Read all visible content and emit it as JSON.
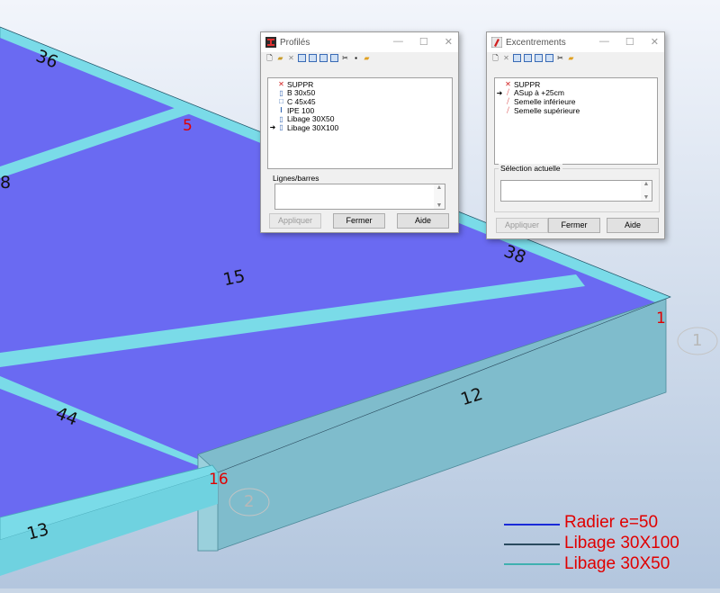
{
  "viewport": {
    "member_labels": [
      "36",
      "8",
      "15",
      "38",
      "44",
      "12",
      "13"
    ],
    "node_labels": [
      "5",
      "1",
      "16"
    ],
    "axis_labels": [
      "1",
      "2"
    ],
    "legend": [
      {
        "label": "Radier e=50",
        "color": "#1a2ad8"
      },
      {
        "label": "Libage 30X100",
        "color": "#2a4a5e"
      },
      {
        "label": "Libage 30X50",
        "color": "#3fb0b0"
      }
    ],
    "colors": {
      "slab": "#6a6af2",
      "beam": "#7adbe8",
      "beam_side": "#7fbccc"
    }
  },
  "profiles_window": {
    "title": "Profilés",
    "items": [
      {
        "label": "SUPPR",
        "icon": "delete-x-icon",
        "selected": false
      },
      {
        "label": "B 30x50",
        "icon": "rect-section-icon",
        "selected": false
      },
      {
        "label": "C 45x45",
        "icon": "square-section-icon",
        "selected": false
      },
      {
        "label": "IPE 100",
        "icon": "i-beam-icon",
        "selected": false
      },
      {
        "label": "Libage 30X50",
        "icon": "rect-section-icon",
        "selected": false
      },
      {
        "label": "Libage 30X100",
        "icon": "rect-section-icon",
        "selected": true
      }
    ],
    "group_label": "Lignes/barres",
    "buttons": {
      "apply": "Appliquer",
      "close": "Fermer",
      "help": "Aide"
    }
  },
  "offsets_window": {
    "title": "Excentrements",
    "items": [
      {
        "label": "SUPPR",
        "icon": "delete-x-icon",
        "selected": false
      },
      {
        "label": "ASup à +25cm",
        "icon": "offset-icon",
        "selected": true
      },
      {
        "label": "Semelle inférieure",
        "icon": "offset-icon",
        "selected": false
      },
      {
        "label": "Semelle supérieure",
        "icon": "offset-icon",
        "selected": false
      }
    ],
    "group_label": "Sélection actuelle",
    "buttons": {
      "apply": "Appliquer",
      "close": "Fermer",
      "help": "Aide"
    }
  }
}
